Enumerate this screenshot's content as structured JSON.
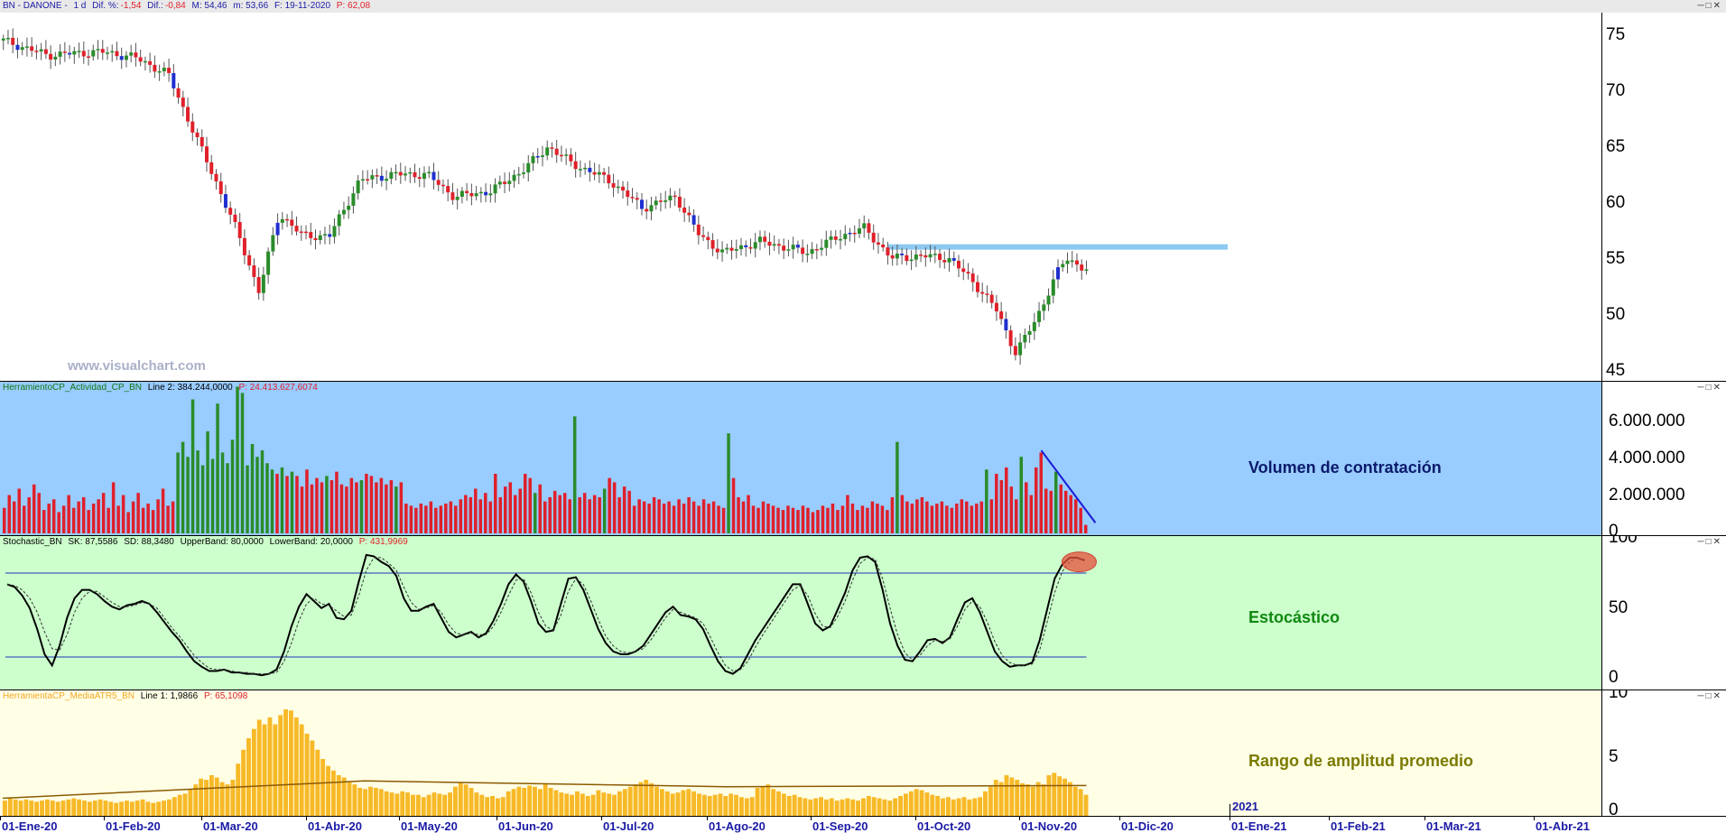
{
  "price_pane": {
    "header": {
      "symbol": "BN - DANONE -",
      "period": "1 d",
      "dif_pct_label": "Dif. %:",
      "dif_pct_value": "-1,54",
      "dif_label": "Dif.:",
      "dif_value": "-0,84",
      "max": "M: 54,46",
      "min": "m: 53,66",
      "date": "F: 19-11-2020",
      "price": "P: 62,08"
    },
    "watermark": "www.visualchart.com",
    "yticks": [
      "75",
      "70",
      "65",
      "60",
      "55",
      "50",
      "45"
    ]
  },
  "volume_pane": {
    "header": {
      "name": "HerramientoCP_Actividad_CP_BN",
      "line": "Line 2: 384.244,0000",
      "p": "P: 24.413.627,6074"
    },
    "title": "Volumen de contratación",
    "yticks": [
      "6.000.000",
      "4.000.000",
      "2.000.000",
      "0"
    ]
  },
  "stoch_pane": {
    "header": {
      "name": "Stochastic_BN",
      "sk": "SK: 87,5586",
      "sd": "SD: 88,3480",
      "upper": "UpperBand: 80,0000",
      "lower": "LowerBand: 20,0000",
      "p": "P: 431,9969"
    },
    "title": "Estocástico",
    "yticks": [
      "100",
      "50",
      "0"
    ]
  },
  "atr_pane": {
    "header": {
      "name": "HerramientaCP_MediaATR5_BN",
      "line": "Line 1: 1,9866",
      "p": "P: 65,1098"
    },
    "title": "Rango de amplitud promedio",
    "yticks": [
      "10",
      "5",
      "0"
    ]
  },
  "x_axis": {
    "labels": [
      "01-Ene-20",
      "01-Feb-20",
      "01-Mar-20",
      "01-Abr-20",
      "01-May-20",
      "01-Jun-20",
      "01-Jul-20",
      "01-Ago-20",
      "01-Sep-20",
      "01-Oct-20",
      "01-Nov-20",
      "01-Dic-20",
      "01-Ene-21",
      "01-Feb-21",
      "01-Mar-21",
      "01-Abr-21"
    ],
    "year_marker": "2021"
  },
  "colors": {
    "up": "#2a8c2a",
    "down": "#e0202a",
    "blue_candle": "#1f2fd0",
    "volume_bg": "#99ccff",
    "stoch_bg": "#ccffcc",
    "atr_bg": "#ffffe6",
    "resistance": "#8cc8f0",
    "atr_bar": "#f7b928"
  },
  "chart_data": [
    {
      "type": "candlestick",
      "title": "BN - DANONE - 1 d",
      "ylim": [
        44,
        77
      ],
      "x_range": [
        "01-Ene-20",
        "01-Abr-21"
      ],
      "close_path": [
        [
          "02-Ene-20",
          74.5
        ],
        [
          "15-Ene-20",
          73.2
        ],
        [
          "31-Ene-20",
          73.5
        ],
        [
          "10-Feb-20",
          73.0
        ],
        [
          "20-Feb-20",
          71.5
        ],
        [
          "28-Feb-20",
          66.0
        ],
        [
          "05-Mar-20",
          62.0
        ],
        [
          "12-Mar-20",
          57.0
        ],
        [
          "18-Mar-20",
          52.0
        ],
        [
          "24-Mar-20",
          59.0
        ],
        [
          "31-Mar-20",
          57.0
        ],
        [
          "08-Abr-20",
          57.0
        ],
        [
          "17-Abr-20",
          62.0
        ],
        [
          "27-Abr-20",
          62.5
        ],
        [
          "07-May-20",
          62.5
        ],
        [
          "15-May-20",
          60.5
        ],
        [
          "26-May-20",
          61.0
        ],
        [
          "05-Jun-20",
          63.0
        ],
        [
          "12-Jun-20",
          65.0
        ],
        [
          "19-Jun-20",
          63.5
        ],
        [
          "30-Jun-20",
          62.0
        ],
        [
          "10-Jul-20",
          59.5
        ],
        [
          "20-Jul-20",
          60.5
        ],
        [
          "27-Jul-20",
          57.0
        ],
        [
          "03-Ago-20",
          55.5
        ],
        [
          "14-Ago-20",
          56.5
        ],
        [
          "28-Ago-20",
          55.5
        ],
        [
          "07-Sep-20",
          57.0
        ],
        [
          "14-Sep-20",
          57.7
        ],
        [
          "22-Sep-20",
          55.0
        ],
        [
          "01-Oct-20",
          55.2
        ],
        [
          "09-Oct-20",
          55.0
        ],
        [
          "16-Oct-20",
          53.0
        ],
        [
          "23-Oct-20",
          50.5
        ],
        [
          "29-Oct-20",
          46.5
        ],
        [
          "04-Nov-20",
          49.5
        ],
        [
          "10-Nov-20",
          53.5
        ],
        [
          "13-Nov-20",
          55.0
        ],
        [
          "19-Nov-20",
          54.0
        ]
      ],
      "annotations": [
        {
          "type": "resistance_band",
          "y": 56,
          "from": "21-Sep-20",
          "to": "31-Dic-20"
        }
      ]
    },
    {
      "type": "bar",
      "title": "Volumen de contratación",
      "ylim": [
        0,
        7000000
      ],
      "x_range": [
        "01-Ene-20",
        "19-Nov-20"
      ],
      "values": [
        1200000,
        1800000,
        1500000,
        2100000,
        1300000,
        1700000,
        2300000,
        1900000,
        1100000,
        1400000,
        1600000,
        1000000,
        1300000,
        1800000,
        1200000,
        1500000,
        1700000,
        1100000,
        1400000,
        1600000,
        1900000,
        1200000,
        2400000,
        1300000,
        1800000,
        1000000,
        1500000,
        1900000,
        1200000,
        1400000,
        1100000,
        1600000,
        2100000,
        1300000,
        1500000,
        3800000,
        4300000,
        3600000,
        6300000,
        3900000,
        3200000,
        4800000,
        3500000,
        6100000,
        3800000,
        3300000,
        4400000,
        6900000,
        6600000,
        3200000,
        4200000,
        3600000,
        3900000,
        3300000,
        3000000,
        2800000,
        3100000,
        2700000,
        2900000,
        2700000,
        2200000,
        3000000,
        2300000,
        2600000,
        2400000,
        2700000,
        2500000,
        2900000,
        2300000,
        2200000,
        2600000,
        2400000,
        2500000,
        2800000,
        2700000,
        2400000,
        2600000,
        2300000,
        2500000,
        2200000,
        2400000,
        1400000,
        1300000,
        1200000,
        1400000,
        1300000,
        1500000,
        1200000,
        1300000,
        1400000,
        1500000,
        1300000,
        1600000,
        1800000,
        1700000,
        2100000,
        1600000,
        1900000,
        1500000,
        2800000,
        1700000,
        2200000,
        2400000,
        1800000,
        2100000,
        2800000,
        2600000,
        1900000,
        2300000,
        1500000,
        1700000,
        2000000,
        1800000,
        1900000,
        1600000,
        5500000,
        1700000,
        1900000,
        1600000,
        1800000,
        1700000,
        2100000,
        2600000,
        2400000,
        1700000,
        2200000,
        2000000,
        1300000,
        1600000,
        1500000,
        1400000,
        1700000,
        1600000,
        1400000,
        1500000,
        1300000,
        1600000,
        1400000,
        1700000,
        1500000,
        1300000,
        1600000,
        1400000,
        1500000,
        1300000,
        1200000,
        4700000,
        2600000,
        1700000,
        1500000,
        1800000,
        1300000,
        1200000,
        1500000,
        1400000,
        1300000,
        1200000,
        1100000,
        1300000,
        1200000,
        1100000,
        1300000,
        1200000,
        1000000,
        1100000,
        1300000,
        1200000,
        1400000,
        1100000,
        1300000,
        1800000,
        1400000,
        1100000,
        1300000,
        1200000,
        1500000,
        1400000,
        1300000,
        1100000,
        1700000,
        4300000,
        1800000,
        1500000,
        1400000,
        1600000,
        1700000,
        1500000,
        1300000,
        1400000,
        1500000,
        1300000,
        1200000,
        1400000,
        1600000,
        1500000,
        1300000,
        1400000,
        1500000,
        3000000,
        1600000,
        2800000,
        2500000,
        3100000,
        2200000,
        1600000,
        3600000,
        2400000,
        1800000,
        3100000,
        3800000,
        2100000,
        2000000,
        2900000,
        2300000,
        2000000,
        1800000,
        1600000,
        1200000,
        400000
      ],
      "annotations": [
        {
          "type": "downtrend_line",
          "from_value": 3900000,
          "to_value": 500000
        }
      ]
    },
    {
      "type": "line",
      "title": "Estocástico",
      "ylim": [
        0,
        100
      ],
      "bands": [
        80,
        20
      ],
      "x_range": [
        "01-Ene-20",
        "19-Nov-20"
      ],
      "series": [
        {
          "name": "SK",
          "values": [
            72,
            70,
            64,
            55,
            40,
            22,
            14,
            28,
            48,
            62,
            68,
            68,
            65,
            60,
            56,
            54,
            57,
            58,
            60,
            58,
            52,
            45,
            38,
            32,
            24,
            17,
            13,
            10,
            10,
            11,
            9,
            9,
            8,
            8,
            7,
            8,
            11,
            24,
            42,
            56,
            65,
            60,
            55,
            58,
            48,
            47,
            53,
            74,
            93,
            92,
            88,
            85,
            78,
            62,
            53,
            53,
            56,
            58,
            48,
            38,
            34,
            36,
            38,
            34,
            37,
            46,
            58,
            72,
            79,
            74,
            60,
            44,
            38,
            39,
            58,
            76,
            77,
            68,
            54,
            40,
            30,
            24,
            22,
            22,
            24,
            28,
            36,
            44,
            52,
            56,
            50,
            49,
            47,
            40,
            28,
            17,
            10,
            8,
            12,
            22,
            32,
            40,
            48,
            56,
            64,
            72,
            72,
            58,
            44,
            39,
            42,
            54,
            66,
            82,
            91,
            92,
            88,
            68,
            44,
            28,
            18,
            17,
            24,
            32,
            33,
            30,
            34,
            47,
            59,
            62,
            52,
            38,
            24,
            17,
            13,
            14,
            14,
            16,
            32,
            54,
            76,
            86,
            91,
            91,
            89
          ]
        },
        {
          "name": "SD",
          "values": [
            72,
            71,
            68,
            62,
            52,
            38,
            26,
            25,
            36,
            52,
            62,
            67,
            67,
            63,
            59,
            56,
            56,
            57,
            59,
            58,
            55,
            48,
            41,
            35,
            28,
            21,
            16,
            12,
            11,
            11,
            10,
            9,
            9,
            8,
            8,
            8,
            9,
            17,
            30,
            46,
            58,
            62,
            58,
            57,
            53,
            49,
            50,
            64,
            82,
            91,
            91,
            87,
            82,
            70,
            59,
            54,
            55,
            57,
            52,
            43,
            37,
            36,
            37,
            36,
            36,
            42,
            52,
            64,
            75,
            76,
            66,
            52,
            42,
            39,
            50,
            67,
            76,
            72,
            60,
            47,
            35,
            28,
            24,
            23,
            24,
            26,
            32,
            40,
            48,
            54,
            52,
            50,
            48,
            44,
            34,
            23,
            14,
            10,
            11,
            17,
            27,
            36,
            44,
            52,
            60,
            68,
            71,
            64,
            51,
            42,
            41,
            49,
            60,
            75,
            87,
            91,
            90,
            76,
            55,
            36,
            23,
            18,
            21,
            28,
            32,
            31,
            33,
            42,
            54,
            60,
            56,
            45,
            31,
            21,
            16,
            14,
            14,
            15,
            25,
            45,
            66,
            81,
            88,
            91,
            90
          ]
        }
      ],
      "annotations": [
        {
          "type": "highlight",
          "target": "overbought peak"
        }
      ]
    },
    {
      "type": "bar",
      "title": "Rango de amplitud promedio",
      "ylim": [
        0,
        10
      ],
      "x_range": [
        "01-Ene-20",
        "19-Nov-20"
      ],
      "values": [
        1.4,
        1.6,
        1.5,
        1.4,
        1.5,
        1.4,
        1.3,
        1.4,
        1.5,
        1.4,
        1.3,
        1.4,
        1.5,
        1.6,
        1.5,
        1.4,
        1.3,
        1.4,
        1.5,
        1.4,
        1.3,
        1.2,
        1.3,
        1.4,
        1.3,
        1.4,
        1.5,
        1.3,
        1.2,
        1.3,
        1.4,
        1.5,
        1.7,
        1.9,
        2.0,
        2.4,
        2.8,
        3.3,
        3.2,
        3.6,
        3.4,
        3.0,
        2.8,
        3.2,
        4.6,
        5.8,
        6.8,
        7.6,
        8.4,
        8.0,
        8.6,
        8.0,
        8.8,
        9.3,
        9.2,
        8.6,
        8.0,
        7.2,
        6.6,
        5.8,
        5.0,
        4.4,
        4.0,
        3.6,
        3.4,
        3.0,
        2.8,
        2.5,
        2.4,
        2.6,
        2.5,
        2.4,
        2.2,
        2.1,
        2.0,
        2.2,
        2.1,
        1.9,
        1.9,
        1.7,
        1.9,
        2.1,
        2.0,
        1.9,
        2.1,
        2.6,
        3.0,
        2.8,
        2.5,
        2.1,
        1.9,
        1.7,
        1.8,
        1.6,
        1.7,
        2.2,
        2.4,
        2.6,
        2.5,
        2.7,
        2.6,
        2.4,
        2.8,
        2.5,
        2.3,
        2.1,
        2.0,
        1.9,
        2.2,
        2.0,
        1.8,
        1.9,
        2.3,
        2.1,
        2.0,
        1.9,
        2.2,
        2.4,
        2.6,
        2.8,
        3.0,
        3.2,
        2.9,
        2.6,
        2.4,
        2.2,
        2.0,
        2.1,
        2.3,
        2.4,
        2.2,
        2.0,
        1.9,
        1.8,
        1.9,
        2.0,
        1.8,
        2.0,
        1.9,
        1.7,
        1.6,
        1.7,
        2.5,
        2.6,
        2.8,
        2.4,
        2.2,
        2.0,
        1.8,
        1.9,
        1.7,
        1.6,
        1.5,
        1.6,
        1.7,
        1.5,
        1.6,
        1.4,
        1.5,
        1.6,
        1.5,
        1.4,
        1.6,
        1.8,
        1.7,
        1.6,
        1.5,
        1.4,
        1.6,
        1.8,
        2.0,
        2.2,
        2.4,
        2.3,
        2.1,
        1.9,
        1.8,
        1.6,
        1.7,
        1.5,
        1.6,
        1.7,
        1.5,
        1.6,
        1.7,
        2.2,
        2.6,
        3.2,
        3.0,
        3.6,
        3.4,
        3.2,
        2.9,
        2.8,
        2.6,
        3.0,
        2.8,
        3.6,
        3.8,
        3.5,
        3.3,
        3.0,
        2.6,
        2.4,
        1.9
      ],
      "series": [
        {
          "name": "Line 1",
          "values": [
            1.6,
            3.1,
            2.6,
            2.7
          ]
        }
      ]
    }
  ]
}
